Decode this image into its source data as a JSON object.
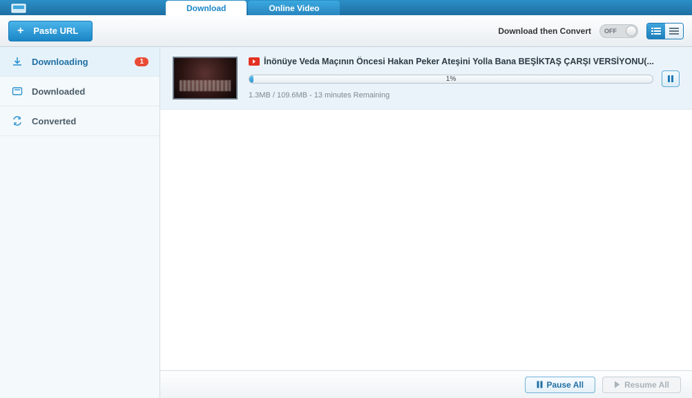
{
  "tabs": {
    "download": "Download",
    "online_video": "Online Video"
  },
  "toolbar": {
    "paste_url": "Paste URL",
    "convert_label": "Download then Convert",
    "toggle_state": "OFF"
  },
  "sidebar": {
    "downloading": {
      "label": "Downloading",
      "badge": "1"
    },
    "downloaded": {
      "label": "Downloaded"
    },
    "converted": {
      "label": "Converted"
    }
  },
  "items": [
    {
      "title": "İnönüye Veda Maçının Öncesi Hakan Peker Ateşini Yolla Bana BEŞİKTAŞ ÇARŞI VERSİYONU(...",
      "progress_text": "1%",
      "progress_pct": 1,
      "status": "1.3MB / 109.6MB - 13 minutes Remaining"
    }
  ],
  "footer": {
    "pause_all": "Pause All",
    "resume_all": "Resume All"
  }
}
